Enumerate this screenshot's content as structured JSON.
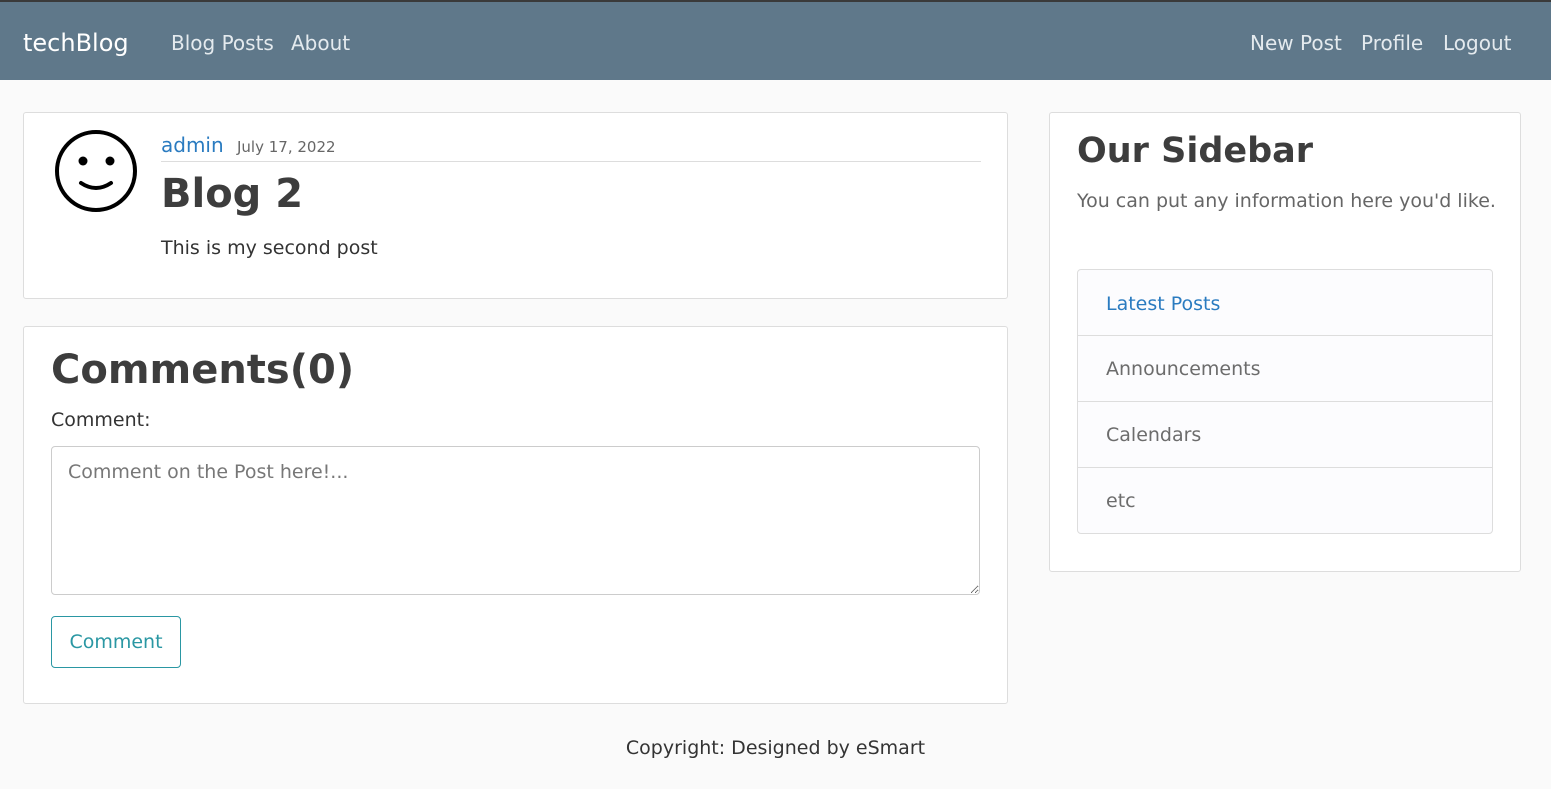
{
  "navbar": {
    "brand": "techBlog",
    "links_left": [
      "Blog Posts",
      "About"
    ],
    "links_right": [
      "New Post",
      "Profile",
      "Logout"
    ],
    "background_color": "#5f788a"
  },
  "post": {
    "author": "admin",
    "date": "July 17, 2022",
    "title": "Blog 2",
    "body": "This is my second post",
    "avatar_icon": "smiley-face-icon"
  },
  "comments": {
    "title": "Comments(0)",
    "label": "Comment:",
    "placeholder": "Comment on the Post here!...",
    "value": "",
    "submit_label": "Comment"
  },
  "sidebar": {
    "title": "Our Sidebar",
    "description": "You can put any information here you'd like.",
    "items": [
      {
        "label": "Latest Posts",
        "active": true
      },
      {
        "label": "Announcements",
        "active": false
      },
      {
        "label": "Calendars",
        "active": false
      },
      {
        "label": "etc",
        "active": false
      }
    ]
  },
  "footer": {
    "text": "Copyright: Designed by eSmart"
  },
  "colors": {
    "link": "#2a7bc0",
    "button_accent": "#2a97a3",
    "page_background": "#fafafa"
  }
}
